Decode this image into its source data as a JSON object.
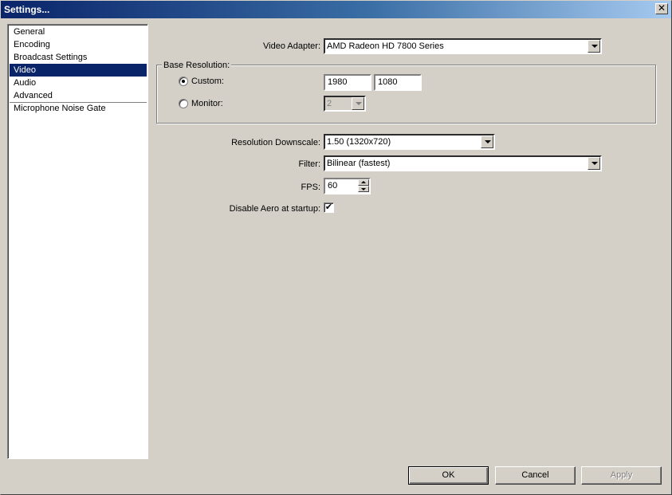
{
  "window": {
    "title": "Settings...",
    "close_glyph": "✕"
  },
  "sidebar": {
    "items": [
      {
        "label": "General"
      },
      {
        "label": "Encoding"
      },
      {
        "label": "Broadcast Settings"
      },
      {
        "label": "Video",
        "selected": true
      },
      {
        "label": "Audio"
      },
      {
        "label": "Advanced"
      },
      {
        "label": "Microphone Noise Gate"
      }
    ]
  },
  "video": {
    "adapter_label": "Video Adapter:",
    "adapter_value": "AMD Radeon HD 7800 Series",
    "base_resolution_title": "Base Resolution:",
    "custom_label": "Custom:",
    "custom_selected": true,
    "custom_width": "1980",
    "custom_height": "1080",
    "monitor_label": "Monitor:",
    "monitor_value": "2",
    "downscale_label": "Resolution Downscale:",
    "downscale_value": "1.50  (1320x720)",
    "filter_label": "Filter:",
    "filter_value": "Bilinear (fastest)",
    "fps_label": "FPS:",
    "fps_value": "60",
    "aero_label": "Disable Aero at startup:",
    "aero_checked": true,
    "check_glyph": "✔"
  },
  "buttons": {
    "ok": "OK",
    "cancel": "Cancel",
    "apply": "Apply"
  },
  "colors": {
    "titlebar_start": "#0a246a",
    "selection": "#0a246a",
    "dialog_bg": "#d4d0c8"
  }
}
